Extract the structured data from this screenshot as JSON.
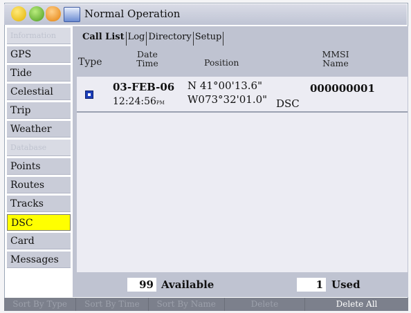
{
  "window": {
    "title": "Normal Operation"
  },
  "sidebar": {
    "items": [
      {
        "label": "Information",
        "disabled": true
      },
      {
        "label": "GPS"
      },
      {
        "label": "Tide"
      },
      {
        "label": "Celestial"
      },
      {
        "label": "Trip"
      },
      {
        "label": "Weather"
      },
      {
        "label": "Database",
        "disabled": true
      },
      {
        "label": "Points"
      },
      {
        "label": "Routes"
      },
      {
        "label": "Tracks"
      },
      {
        "label": "DSC",
        "selected": true
      },
      {
        "label": "Card"
      },
      {
        "label": "Messages"
      }
    ]
  },
  "tabs": [
    "Call List",
    "Log",
    "Directory",
    "Setup"
  ],
  "columns": {
    "type": "Type",
    "date_time": [
      "Date",
      "Time"
    ],
    "position": "Position",
    "mmsi_name": [
      "MMSI",
      "Name"
    ]
  },
  "calls": [
    {
      "type_icon": "dsc-call-icon",
      "date": "03-FEB-06",
      "time": "12:24:56",
      "ampm": "PM",
      "lat": "N  41°00'13.6\"",
      "lon": "W073°32'01.0\"",
      "source": "DSC",
      "mmsi": "000000001"
    }
  ],
  "footer": {
    "available_count": "99",
    "available_label": "Available",
    "used_count": "1",
    "used_label": "Used"
  },
  "softkeys": [
    {
      "label": "Sort By Type",
      "enabled": false
    },
    {
      "label": "Sort By Time",
      "enabled": false
    },
    {
      "label": "Sort By Name",
      "enabled": false
    },
    {
      "label": "Delete",
      "enabled": false
    },
    {
      "label": "Delete All",
      "enabled": true
    }
  ],
  "colors": {
    "selected": "#ffff00",
    "panel": "#bfc3d1",
    "list_bg": "#ececf3"
  }
}
